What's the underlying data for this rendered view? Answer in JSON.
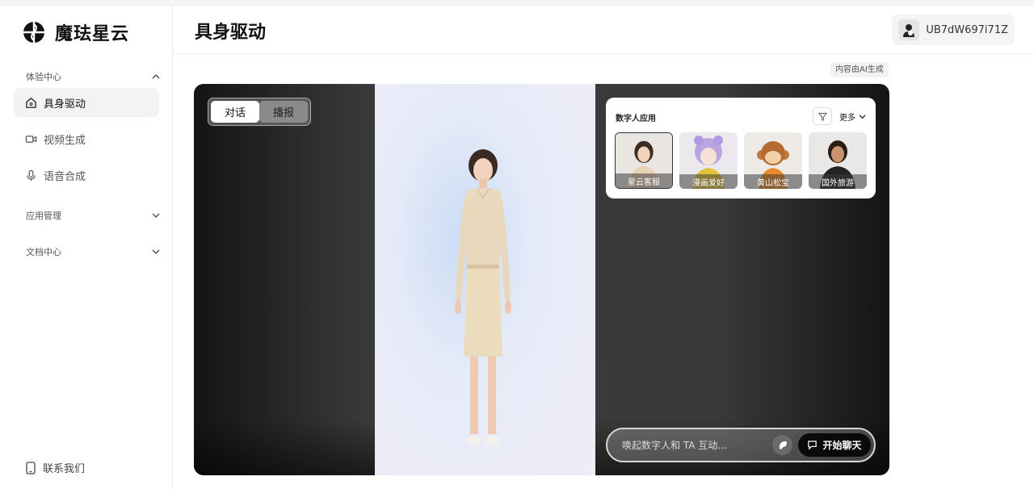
{
  "brand": {
    "name": "魔珐星云"
  },
  "sidebar": {
    "sections": [
      {
        "label": "体验中心",
        "expanded": true
      },
      {
        "label": "应用管理",
        "expanded": false
      },
      {
        "label": "文档中心",
        "expanded": false
      }
    ],
    "items": [
      {
        "label": "具身驱动",
        "icon": "home-icon",
        "active": true
      },
      {
        "label": "视频生成",
        "icon": "video-icon",
        "active": false
      },
      {
        "label": "语音合成",
        "icon": "microphone-icon",
        "active": false
      }
    ],
    "contact": {
      "label": "联系我们",
      "icon": "phone-icon"
    }
  },
  "header": {
    "title": "具身驱动",
    "user": {
      "name": "UB7dW697i71Z"
    }
  },
  "ai_badge": "内容由AI生成",
  "stage": {
    "modes": [
      {
        "label": "对话",
        "active": true
      },
      {
        "label": "播报",
        "active": false
      }
    ],
    "apps": {
      "title": "数字人应用",
      "more_label": "更多",
      "tiles": [
        {
          "label": "星云客服",
          "selected": true
        },
        {
          "label": "漫画爱好",
          "selected": false
        },
        {
          "label": "黄山松宝",
          "selected": false
        },
        {
          "label": "国外旅游",
          "selected": false
        }
      ]
    },
    "chat": {
      "placeholder": "唤起数字人和 TA 互动...",
      "start_label": "开始聊天"
    }
  },
  "colors": {
    "accent": "#0a0a0a",
    "sidebar_active_bg": "#f2f3f5"
  }
}
